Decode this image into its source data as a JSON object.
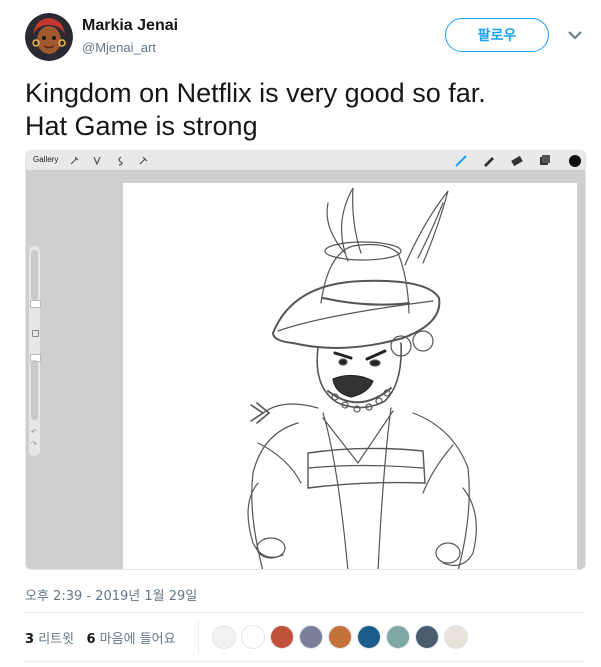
{
  "user": {
    "name": "Markia Jenai",
    "handle": "@Mjenai_art",
    "follow_label": "팔로우"
  },
  "tweet": {
    "lines": [
      "Kingdom on Netflix is very good so far.",
      "Hat Game is strong"
    ]
  },
  "media": {
    "app_toolbar": {
      "gallery_label": "Gallery"
    },
    "colors": {
      "brush_active": "#1da1f2",
      "color_swatch": "#111111"
    }
  },
  "timestamp": "오후 2:39 - 2019년 1월 29일",
  "stats": {
    "retweets_count": "3",
    "retweets_label": "리트윗",
    "likes_count": "6",
    "likes_label": "마음에 들어요"
  },
  "likers": [
    {
      "icon": "avatar-sketch",
      "color": "#f2f2f2"
    },
    {
      "icon": "avatar-bird",
      "color": "#ffffff"
    },
    {
      "icon": "avatar-red",
      "color": "#c0513a"
    },
    {
      "icon": "avatar-photo",
      "color": "#7a7f9a"
    },
    {
      "icon": "avatar-hair",
      "color": "#c4733a"
    },
    {
      "icon": "avatar-blue",
      "color": "#1b5e8c"
    },
    {
      "icon": "avatar-glasses",
      "color": "#7fa7a3"
    },
    {
      "icon": "avatar-group",
      "color": "#4a5d6e"
    },
    {
      "icon": "avatar-girl",
      "color": "#e9e2da"
    }
  ],
  "accent_color": "#1da1f2"
}
